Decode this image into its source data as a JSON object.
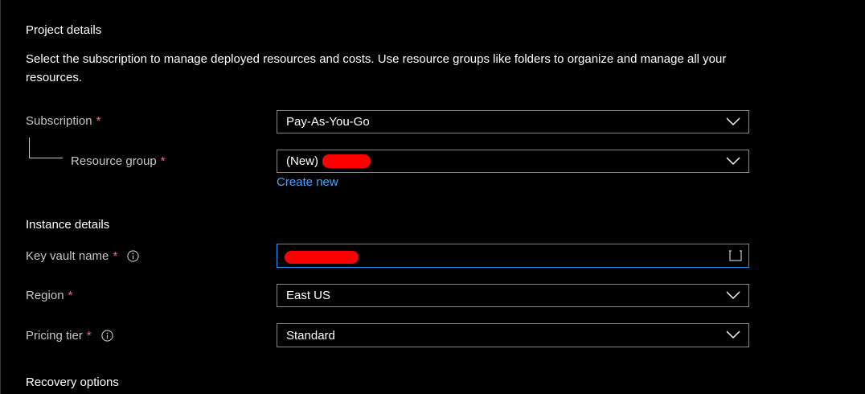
{
  "project": {
    "title": "Project details",
    "description": "Select the subscription to manage deployed resources and costs. Use resource groups like folders to organize and manage all your resources."
  },
  "subscription": {
    "label": "Subscription",
    "required_marker": "*",
    "value": "Pay-As-You-Go"
  },
  "resource_group": {
    "label": "Resource group",
    "required_marker": "*",
    "value_prefix": "(New)",
    "create_new_label": "Create new"
  },
  "instance": {
    "title": "Instance details"
  },
  "key_vault_name": {
    "label": "Key vault name",
    "required_marker": "*"
  },
  "region": {
    "label": "Region",
    "required_marker": "*",
    "value": "East US"
  },
  "pricing_tier": {
    "label": "Pricing tier",
    "required_marker": "*",
    "value": "Standard"
  },
  "recovery": {
    "title": "Recovery options"
  },
  "icons": {
    "dropdown": "chevron-down-icon",
    "info": "info-icon",
    "input_suffix": "text-input-icon"
  },
  "colors": {
    "background": "#000000",
    "label": "#c8c6c4",
    "required": "#f1707b",
    "link": "#4ba3f4",
    "focus_border": "#2899f5",
    "redaction": "#ff0000"
  }
}
